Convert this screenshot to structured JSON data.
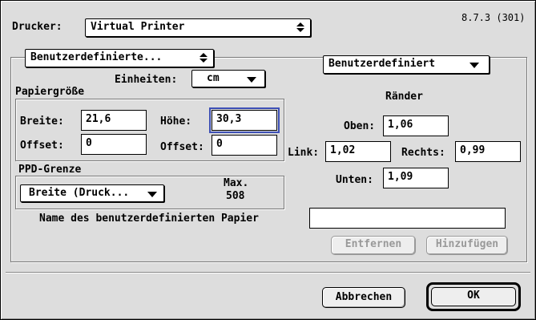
{
  "version": "8.7.3 (301)",
  "printer": {
    "label": "Drucker:",
    "value": "Virtual Printer"
  },
  "section_popup": "Benutzerdefinierte...",
  "custom_popup": "Benutzerdefiniert",
  "units": {
    "label": "Einheiten:",
    "value": "cm"
  },
  "paper_size": {
    "title": "Papiergröße",
    "width_label": "Breite:",
    "width_value": "21,6",
    "height_label": "Höhe:",
    "height_value": "30,3",
    "offset1_label": "Offset:",
    "offset1_value": "0",
    "offset2_label": "Offset:",
    "offset2_value": "0"
  },
  "margins": {
    "title": "Ränder",
    "top_label": "Oben:",
    "top_value": "1,06",
    "left_label": "Link:",
    "left_value": "1,02",
    "right_label": "Rechts:",
    "right_value": "0,99",
    "bottom_label": "Unten:",
    "bottom_value": "1,09"
  },
  "ppd": {
    "title": "PPD-Grenze",
    "popup": "Breite (Druck...",
    "max_label": "Max.",
    "max_value": "508"
  },
  "custom_paper_name": {
    "label": "Name des benutzerdefinierten Papier",
    "value": ""
  },
  "buttons": {
    "remove": "Entfernen",
    "add": "Hinzufügen",
    "cancel": "Abbrechen",
    "ok": "OK"
  }
}
